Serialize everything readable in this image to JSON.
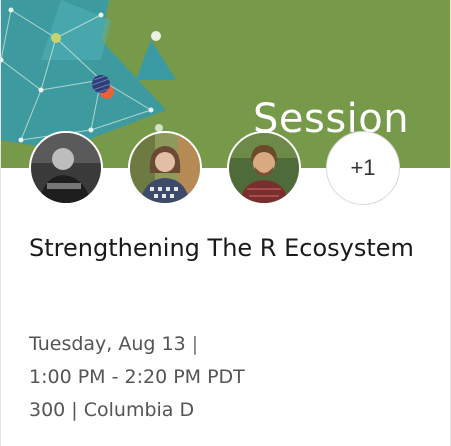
{
  "banner": {
    "label": "Session",
    "color": "#76994a",
    "accent_color": "#3a9aa3"
  },
  "speakers": {
    "avatars": [
      {
        "icon": "avatar-person-1"
      },
      {
        "icon": "avatar-person-2"
      },
      {
        "icon": "avatar-person-3"
      }
    ],
    "more_count": "+1"
  },
  "session": {
    "title": "Strengthening The R Ecosystem",
    "date": "Tuesday, Aug 13",
    "date_separator": "|",
    "time": "1:00 PM - 2:20 PM PDT",
    "location": "300 | Columbia D"
  }
}
